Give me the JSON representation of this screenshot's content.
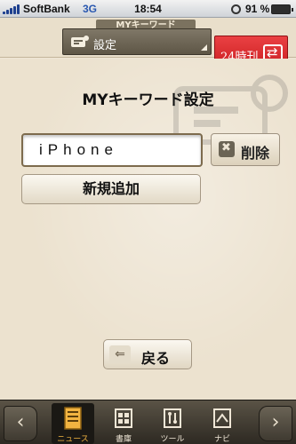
{
  "status_bar": {
    "carrier": "SoftBank",
    "network": "3G",
    "time": "18:54",
    "battery_percent": "91 %"
  },
  "header": {
    "keyword_tab": "MYキーワード",
    "settings_label": "設定",
    "h24_label": "24時刊"
  },
  "main": {
    "title": "MYキーワード設定",
    "keyword_value": "iPhone",
    "delete_label": "削除",
    "add_label": "新規追加",
    "back_label": "戻る"
  },
  "tabbar": {
    "tabs": [
      {
        "label": "ニュース",
        "icon": "news-icon",
        "active": true
      },
      {
        "label": "書庫",
        "icon": "library-icon",
        "active": false
      },
      {
        "label": "ツール",
        "icon": "tools-icon",
        "active": false
      },
      {
        "label": "ナビ",
        "icon": "navi-icon",
        "active": false
      }
    ]
  },
  "colors": {
    "accent_red": "#d42a2d",
    "background": "#ece2cf",
    "tab_active": "#f2b441"
  }
}
